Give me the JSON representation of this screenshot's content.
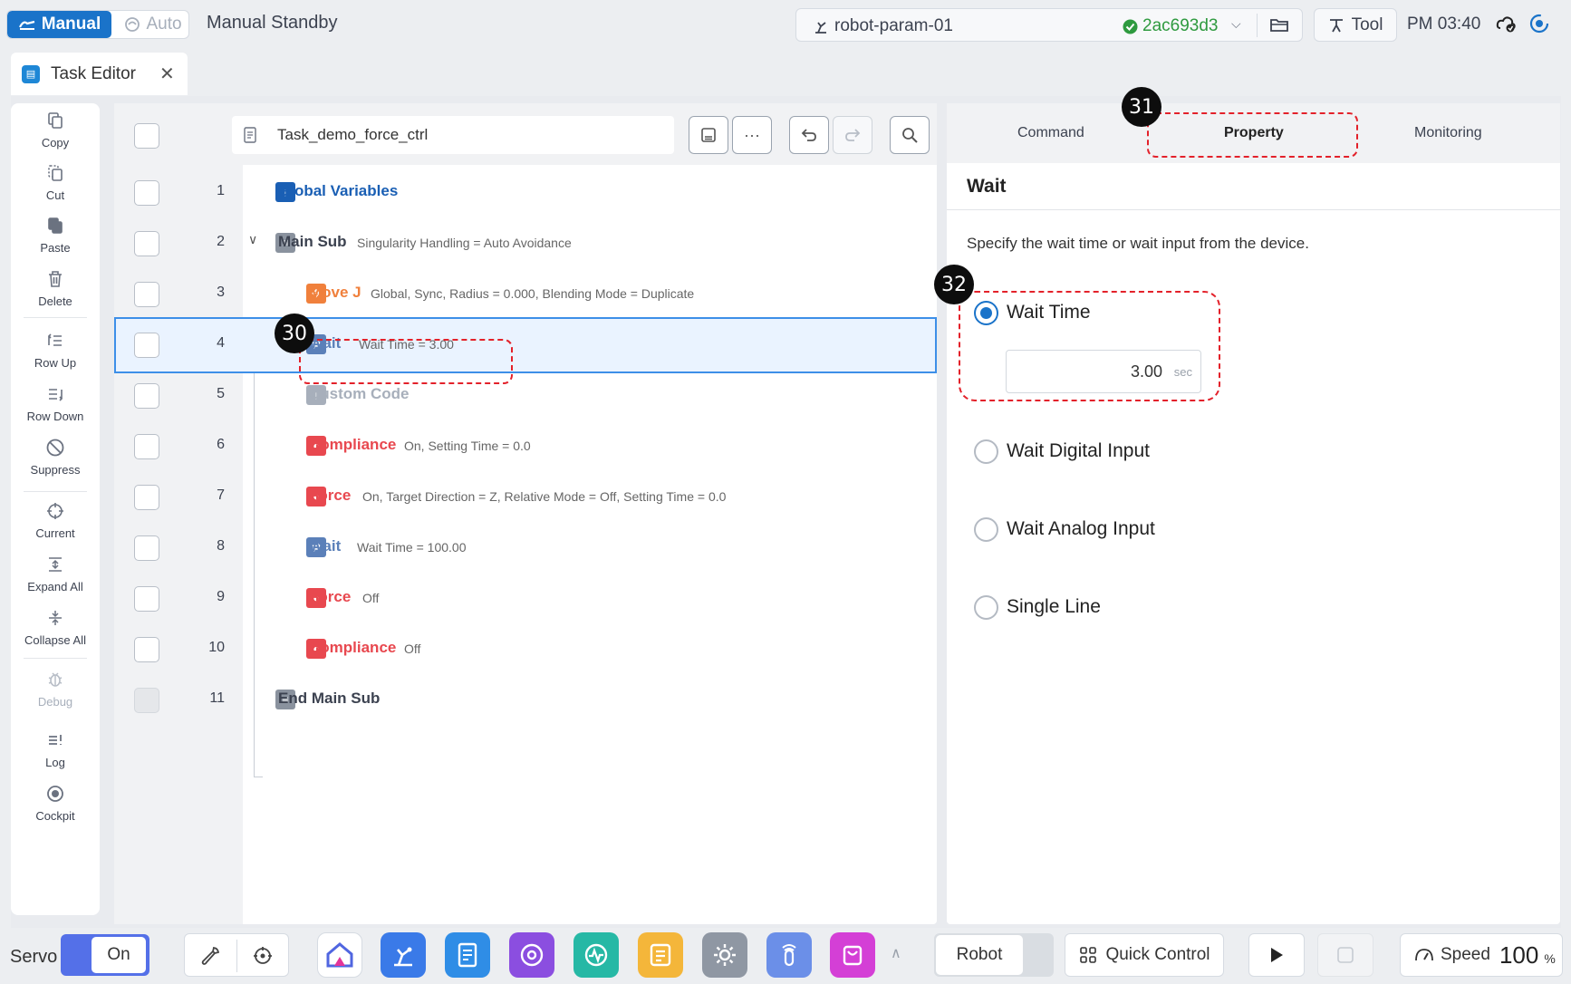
{
  "topbar": {
    "mode_manual": "Manual",
    "mode_auto": "Auto",
    "status": "Manual Standby",
    "param_name": "robot-param-01",
    "param_hash": "2ac693d3",
    "tool_label": "Tool",
    "clock": "PM 03:40"
  },
  "tab": {
    "label": "Task Editor",
    "close": "✕"
  },
  "leftbar": {
    "items": [
      {
        "label": "Copy",
        "icon": "copy-icon"
      },
      {
        "label": "Cut",
        "icon": "cut-icon"
      },
      {
        "label": "Paste",
        "icon": "paste-icon"
      },
      {
        "label": "Delete",
        "icon": "delete-icon"
      },
      {
        "label": "Row Up",
        "icon": "row-up-icon"
      },
      {
        "label": "Row Down",
        "icon": "row-down-icon"
      },
      {
        "label": "Suppress",
        "icon": "suppress-icon"
      },
      {
        "label": "Current",
        "icon": "current-icon"
      },
      {
        "label": "Expand All",
        "icon": "expand-all-icon"
      },
      {
        "label": "Collapse All",
        "icon": "collapse-all-icon"
      },
      {
        "label": "Debug",
        "icon": "debug-icon",
        "disabled": true
      },
      {
        "label": "Log",
        "icon": "log-icon"
      },
      {
        "label": "Cockpit",
        "icon": "cockpit-icon"
      }
    ]
  },
  "task": {
    "name": "Task_demo_force_ctrl",
    "more_label": "···",
    "rows": [
      {
        "num": "1",
        "name": "Global Variables",
        "desc": "",
        "kind": "global"
      },
      {
        "num": "2",
        "name": "Main Sub",
        "desc": "Singularity Handling = Auto Avoidance",
        "kind": "sub"
      },
      {
        "num": "3",
        "name": "Move J",
        "desc": "Global, Sync, Radius = 0.000, Blending Mode = Duplicate",
        "kind": "move"
      },
      {
        "num": "4",
        "name": "Wait",
        "desc": "Wait Time = 3.00",
        "kind": "wait",
        "selected": true
      },
      {
        "num": "5",
        "name": "Custom Code",
        "desc": "",
        "kind": "custom"
      },
      {
        "num": "6",
        "name": "Compliance",
        "desc": "On, Setting Time = 0.0",
        "kind": "force"
      },
      {
        "num": "7",
        "name": "Force",
        "desc": "On, Target Direction = Z, Relative Mode = Off, Setting Time = 0.0",
        "kind": "force"
      },
      {
        "num": "8",
        "name": "Wait",
        "desc": "Wait Time = 100.00",
        "kind": "wait"
      },
      {
        "num": "9",
        "name": "Force",
        "desc": "Off",
        "kind": "force"
      },
      {
        "num": "10",
        "name": "Compliance",
        "desc": "Off",
        "kind": "force"
      },
      {
        "num": "11",
        "name": "End Main Sub",
        "desc": "",
        "kind": "sub"
      }
    ]
  },
  "property": {
    "tabs": [
      "Command",
      "Property",
      "Monitoring"
    ],
    "active_tab": "Property",
    "title": "Wait",
    "description": "Specify the wait time or wait input from the device.",
    "options": [
      "Wait Time",
      "Wait Digital Input",
      "Wait Analog Input",
      "Single Line"
    ],
    "selected_option": "Wait Time",
    "wait_time_value": "3.00",
    "wait_time_unit": "sec"
  },
  "annotations": {
    "m30": "30",
    "m31": "31",
    "m32": "32"
  },
  "bottombar": {
    "servo_label": "Servo",
    "servo_state": "On",
    "robot_label": "Robot",
    "quick_control": "Quick Control",
    "speed_label": "Speed",
    "speed_value": "100",
    "speed_unit": "%"
  },
  "colors": {
    "accent": "#1a73c9",
    "move": "#f0803c",
    "force": "#e8484f",
    "wait": "#5b80b9",
    "global": "#1a5fb4",
    "annotation": "#e3212a"
  }
}
